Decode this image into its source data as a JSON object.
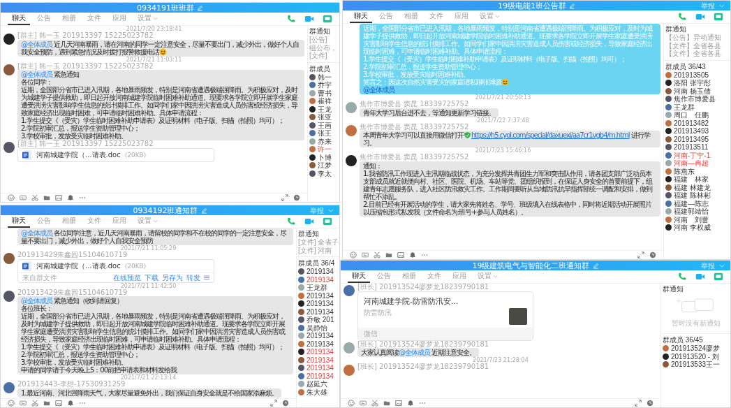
{
  "windows": [
    {
      "title": "0934191班班群",
      "tabs": [
        {
          "label": "聊天",
          "selected": true,
          "dropdown": false
        },
        {
          "label": "公告",
          "selected": false,
          "dropdown": false
        },
        {
          "label": "相册",
          "selected": false,
          "dropdown": false
        },
        {
          "label": "文件",
          "selected": false,
          "dropdown": false
        },
        {
          "label": "应用",
          "selected": false,
          "dropdown": false
        },
        {
          "label": "设置",
          "selected": false,
          "dropdown": true
        }
      ],
      "messages": [
        {
          "timestamp": "2021/7/20 23:18:41",
          "sender": "[群主] 韩一玉 201913397 15225023782",
          "kind": "text",
          "highlighted": false,
          "paragraphs": [
            [
              {
                "kind": "mention",
                "t": "@全体成员"
              },
              {
                "kind": "plain",
                "t": " 近几天河南暴雨，请在河南的同学一定注意安全，尽量不要出门，减少外出，做好个人自我安全预防，遇到紧急情况及时拨打报警救援电话"
              },
              {
                "kind": "emoji"
              }
            ]
          ]
        },
        {
          "timestamp": "2021/7/21 11:03:11",
          "sender": "[群主] 韩一玉 201913397 15225023782",
          "kind": "text",
          "highlighted": false,
          "paragraphs": [
            [
              {
                "kind": "mention",
                "t": "@全体成员"
              },
              {
                "kind": "plain",
                "t": "  紧急通知"
              }
            ],
            [
              {
                "kind": "plain",
                "t": "各位同学："
              }
            ],
            [
              {
                "kind": "plain",
                "t": "近期，全国部分省市已进入汛期，各地暴雨频发，特别是河南省遭遇极端强降雨。为积极应对，及时为城建学子提供救助，即日起开放河南城建学院临时困难补助通道。现要求各学院立即开展学生家庭遭受洪涝灾害影响学生信息的统计摸排工作。如同学们家中因洪涝灾害造成人员伤害或经济损失，导致家庭经济出现临时困难，可申请临时困难补助。具体申请流程："
              }
            ],
            [
              {
                "kind": "plain",
                "t": "1.学生提交《（受灾）学生临时困难补助申请表》及证明材料（电子版、扫描（拍照）均可）；"
              }
            ],
            [
              {
                "kind": "plain",
                "t": "2.学院初审汇总，报送学生资助管理中心；"
              }
            ],
            [
              {
                "kind": "plain",
                "t": "3.学校审批，发放受灾临时困难补助。"
              }
            ]
          ]
        },
        {
          "sender": "[群主] 韩一玉 201913397 15225023782",
          "kind": "file",
          "file_name": "河南城建学院（...请表.doc",
          "file_size": "(20KB)"
        }
      ],
      "side": {
        "notice_title": "群通知",
        "notices": [
          "[公告]",
          "组公布，",
          "[文件]"
        ],
        "members_title": "群成员",
        "members": [
          {
            "name": "韩一",
            "flagged": false
          },
          {
            "name": "乔宇",
            "flagged": false
          },
          {
            "name": "曹书",
            "flagged": false
          },
          {
            "name": "崔祥",
            "flagged": false
          },
          {
            "name": "王龙",
            "flagged": false
          },
          {
            "name": "张亚",
            "flagged": false
          },
          {
            "name": "王画",
            "flagged": false
          },
          {
            "name": "张王",
            "flagged": false
          },
          {
            "name": "赤来",
            "flagged": false
          },
          {
            "name": "许一",
            "flagged": true
          },
          {
            "name": "卜博",
            "flagged": false
          },
          {
            "name": "江梦",
            "flagged": false
          },
          {
            "name": "李太",
            "flagged": false
          }
        ]
      }
    },
    {
      "title": "19级电能1班公告群",
      "title_action": "举报",
      "tabs": [
        {
          "label": "聊天",
          "selected": true,
          "dropdown": false
        },
        {
          "label": "公告",
          "selected": false,
          "dropdown": false
        },
        {
          "label": "相册",
          "selected": false,
          "dropdown": false
        },
        {
          "label": "文件",
          "selected": false,
          "dropdown": false
        },
        {
          "label": "应用",
          "selected": false,
          "dropdown": false
        },
        {
          "label": "设置",
          "selected": false,
          "dropdown": true
        }
      ],
      "messages": [
        {
          "kind": "text",
          "highlighted": true,
          "paragraphs": [
            [
              {
                "kind": "plain",
                "t": "近期，全国部分省市已进入汛期，各地暴雨频发，特别是河南省遭遇极端强降雨。为积极应对，及时为城建学子提供救助，即日起开放河南城建学院临时困难补助通道。现要求各学院立即开展学生家庭遭受洪涝灾害影响学生信息的统计摸排工作。如同学们家中因洪涝灾害造成人员伤害或经济损失，导致家庭经济出现临时困难，可申请临时困难补助。具体申请流程："
              }
            ],
            [
              {
                "kind": "plain",
                "t": "1.学生提交《（受灾）学生临时困难补助申请表》及证明材料（电子版、扫描（拍照）均可）；"
              }
            ],
            [
              {
                "kind": "plain",
                "t": "2.学院初审汇总，报送学生资助管理中心；"
              }
            ],
            [
              {
                "kind": "plain",
                "t": "3.学校审批，发放受灾临时困难补助。"
              }
            ],
            [
              {
                "kind": "plain",
                "t": "简言之：因这次自然灾害受灾的家庭请私聊张博源"
              },
              {
                "kind": "emoji"
              }
            ],
            [
              {
                "kind": "mention",
                "t": "@全体成员"
              }
            ]
          ]
        },
        {
          "timestamp": "2021/7/21 20:50:13",
          "sender": "焦作市博爱县  窦昆  18339725752",
          "kind": "text",
          "highlighted": false,
          "paragraphs": [
            [
              {
                "kind": "plain",
                "t": "青年大学习后台进不去，等通知更新学习链接。"
              }
            ]
          ]
        },
        {
          "timestamp": "2021/7/22 7:37:48",
          "sender": "焦作市博爱县  窦昆  18339725752",
          "kind": "text",
          "highlighted": false,
          "paragraphs": [
            [
              {
                "kind": "plain",
                "t": "本周青年大学习可以直接用微信打开"
              },
              {
                "kind": "check"
              },
              {
                "kind": "link",
                "t": "https://h5.cyol.com/special/daxuexi/aa7cr1vgb4/m.html"
              },
              {
                "kind": "plain",
                "t": " 进行学习。"
              }
            ]
          ]
        },
        {
          "timestamp": "2021/7/23 15:46:16",
          "sender": "焦作市博爱县  窦昆  18339725752",
          "kind": "text",
          "highlighted": false,
          "paragraphs": [
            [
              {
                "kind": "plain",
                "t": "通知："
              }
            ],
            [
              {
                "kind": "plain",
                "t": "1.我省防汛工作现进入主汛期临战状态，为充分发挥共青团生力军和突击队作用，请各团支部广泛动员本支部成员就近就便向村、社区、医院、机场、车站等党、团组织报到，在保证人身安全的首要前提下，组建青年志愿服务队，进入社区防汛救灾工作。工作期间要听从当地防汛抗旱指挥部统一调配和安排，做到帮忙不添乱。"
              }
            ],
            [
              {
                "kind": "plain",
                "t": "2.目前已经有开展活动的学生，请大家先将姓名、学号、班级填入在线表格中，同时将近期活动开展照片以压缩包形式私发我（文件命名为:班号+参与人员姓名）。"
              }
            ]
          ]
        }
      ],
      "side": {
        "notice_title": "群通知",
        "notices": [
          "【公告】异动通知",
          "【文件】全省各县",
          "【文件】全省各县"
        ],
        "members_title": "群成员 36/43",
        "members": [
          {
            "name": "201913505",
            "flagged": false
          },
          {
            "name": "洛阳 张宇彤",
            "flagged": false
          },
          {
            "name": "河南 杨玉倩",
            "flagged": false
          },
          {
            "name": "焦作市博爱县",
            "flagged": false
          },
          {
            "name": "王龙群",
            "flagged": false
          },
          {
            "name": "周口　任鹏",
            "flagged": false
          },
          {
            "name": "201913482",
            "flagged": false
          },
          {
            "name": "201913493",
            "flagged": false
          },
          {
            "name": "201913495",
            "flagged": false
          },
          {
            "name": "201913511",
            "flagged": false
          },
          {
            "name": "河南-丁宁-1",
            "flagged": true
          },
          {
            "name": "河南—冉超",
            "flagged": true
          },
          {
            "name": "陈燕东",
            "flagged": false
          },
          {
            "name": "福建　林家",
            "flagged": false
          },
          {
            "name": "福建 林建龙",
            "flagged": false
          },
          {
            "name": "福建 陈林彬",
            "flagged": false
          },
          {
            "name": "福建—陈志",
            "flagged": false
          },
          {
            "name": "福建郭靖怡",
            "flagged": false
          },
          {
            "name": "河南　刘蕾",
            "flagged": false
          },
          {
            "name": "河南 李权威",
            "flagged": false
          }
        ]
      }
    },
    {
      "title": "0934192班通知群",
      "title_action": "举报",
      "tabs": [
        {
          "label": "聊天",
          "selected": true,
          "dropdown": false
        },
        {
          "label": "公告",
          "selected": false,
          "dropdown": false
        },
        {
          "label": "相册",
          "selected": false,
          "dropdown": false
        },
        {
          "label": "文件",
          "selected": false,
          "dropdown": false
        },
        {
          "label": "应用",
          "selected": false,
          "dropdown": false
        },
        {
          "label": "设置",
          "selected": false,
          "dropdown": true
        }
      ],
      "messages": [
        {
          "kind": "text",
          "highlighted": false,
          "paragraphs": [
            [
              {
                "kind": "mention",
                "t": "@全体成员"
              },
              {
                "kind": "plain",
                "t": " 各位同学注意，近几天河南暴雨，请留校的同学和不在校的同学的一定注意安全，尽量不要出门，减少外出，做好个人自我安全预防"
              }
            ]
          ]
        },
        {
          "timestamp": "2021/7/21 11:05:29",
          "sender": "201913429朱鑫园15104610719",
          "kind": "file",
          "file_name": "河南城建学院（...请表.doc",
          "file_size": "(20KB)",
          "source": "来自群文件",
          "actions": [
            "在线预览",
            "下载",
            "另存为",
            "转发"
          ]
        },
        {
          "timestamp": "2021/7/21 11:42:50",
          "sender": "201913429朱鑫园15104610719",
          "kind": "text",
          "highlighted": false,
          "paragraphs": [
            [
              {
                "kind": "mention",
                "t": "@全体成员"
              },
              {
                "kind": "plain",
                "t": "  紧急通知（收到请回复）"
              }
            ],
            [
              {
                "kind": "plain",
                "t": "各位班长："
              }
            ],
            [
              {
                "kind": "plain",
                "t": "近期，全国部分省市已进入汛期，各地暴雨频发，特别是河南省遭遇极端强降雨。为积极应对，及时为城建学子提供救助，即日起开放河南城建学院临时困难补助通道。现要求各学院立即开展学生家庭遭受洪涝灾害影响学生信息的统计摸排工作。如同学们家中因洪涝灾害造成人员伤害或经济损失，导致家庭经济出现临时困难，可申请临时困难补助。具体申请流程："
              }
            ],
            [
              {
                "kind": "plain",
                "t": "1.学生提交《（受灾）学生临时困难补助申请表》及证明材料（电子版、扫描（拍照）均可）；"
              }
            ],
            [
              {
                "kind": "plain",
                "t": "2.学院初审汇总，报送学生资助管理中心；"
              }
            ],
            [
              {
                "kind": "plain",
                "t": "3.学校审批，发放受灾临时困难补助。"
              }
            ],
            [
              {
                "kind": "plain",
                "t": "申请的同学请于今天晚上5：00前把申请表和材料发给我"
              }
            ]
          ]
        },
        {
          "timestamp": "2021/7/21 22:13:14",
          "sender": "201913443-李想-17530931259",
          "kind": "text",
          "highlighted": false,
          "paragraphs": [
            [
              {
                "kind": "plain",
                "t": "1.最近河南、河北强降雨天气，大家尽量避免外出，我们保证自身安全就是不给国家添麻烦。"
              }
            ]
          ]
        }
      ],
      "side": {
        "notice_title": "群通知",
        "notices": [
          "[文件] 全省子",
          "[文件] 河南"
        ],
        "members_title": "群成员 36/4",
        "members": [
          {
            "name": "2019134",
            "flagged": false
          },
          {
            "name": "2019134",
            "flagged": true
          },
          {
            "name": "王龙群",
            "flagged": false
          },
          {
            "name": "2019134",
            "flagged": false
          },
          {
            "name": "2019134",
            "flagged": false
          },
          {
            "name": "2019134",
            "flagged": false
          },
          {
            "name": "乔敏 201",
            "flagged": false
          },
          {
            "name": "吴静怡",
            "flagged": false
          },
          {
            "name": "2019134",
            "flagged": false
          },
          {
            "name": "2019134",
            "flagged": false
          },
          {
            "name": "2019134",
            "flagged": true
          },
          {
            "name": "2019134",
            "flagged": true
          },
          {
            "name": "2019134",
            "flagged": true
          },
          {
            "name": "2019134",
            "flagged": true
          },
          {
            "name": "赵延六",
            "flagged": false
          },
          {
            "name": "朱大雄",
            "flagged": false
          }
        ]
      }
    },
    {
      "title": "19级建筑电气与智能化二班通知群",
      "title_action": "举报",
      "tabs": [
        {
          "label": "聊天",
          "selected": true,
          "dropdown": false
        },
        {
          "label": "公告",
          "selected": false,
          "dropdown": false
        },
        {
          "label": "相册",
          "selected": false,
          "dropdown": false
        },
        {
          "label": "文件",
          "selected": false,
          "dropdown": false
        },
        {
          "label": "应用",
          "selected": false,
          "dropdown": false
        },
        {
          "label": "设置",
          "selected": false,
          "dropdown": true
        }
      ],
      "messages": [
        {
          "sender": "[班长]  201913524廖梦龙18239790181",
          "kind": "card",
          "card_title": "河南城建学院-防雷防汛安...",
          "card_subtitle": "防雷防汛",
          "card_source": "微信"
        },
        {
          "sender": "[班长]  201913524廖梦龙18239790181",
          "kind": "text",
          "highlighted": false,
          "paragraphs": [
            [
              {
                "kind": "plain",
                "t": "大家认真阅读"
              },
              {
                "kind": "mention",
                "t": "@全体成员"
              },
              {
                "kind": "plain",
                "t": " 近期注意安全。"
              }
            ]
          ]
        },
        {
          "timestamp": "2021/7/23 21:28:04",
          "sender": "[班长]  201913524廖梦龙18239790181",
          "kind": "none"
        }
      ],
      "side": {
        "notice_title": "群通知",
        "empty_notice": "暂时没有新通知",
        "members_title": "群成员 36/45",
        "members": [
          {
            "name": "201913524廖梦",
            "flagged": false
          },
          {
            "name": "201913520 - 刘",
            "flagged": false
          },
          {
            "name": "201913533王一",
            "flagged": false
          }
        ]
      }
    }
  ]
}
